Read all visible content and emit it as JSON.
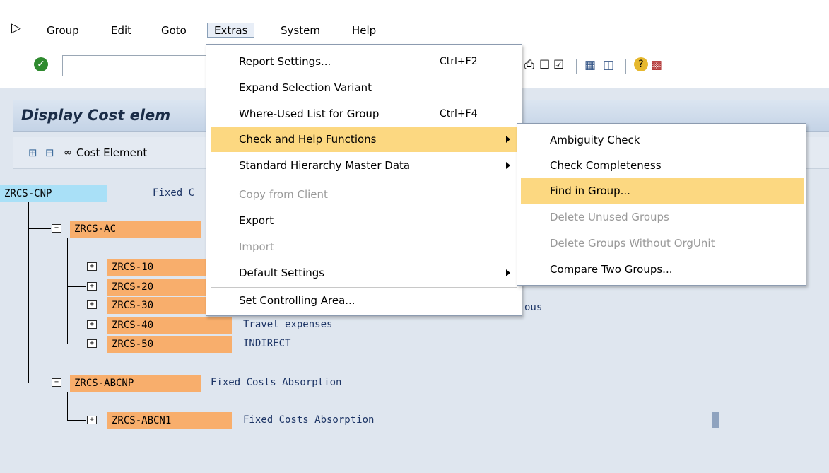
{
  "menubar": {
    "items": [
      "Group",
      "Edit",
      "Goto",
      "Extras",
      "System",
      "Help"
    ],
    "active": "Extras"
  },
  "toolbar": {
    "icons": [
      "enter-check-icon",
      "print-icon",
      "find-icon",
      "find-next-icon",
      "create-session-icon",
      "shortcut-icon",
      "help-icon",
      "customize-layout-icon"
    ]
  },
  "title": "Display Cost elem",
  "app_toolbar": {
    "cost_element_label": "Cost Element"
  },
  "extras_menu": {
    "items": [
      {
        "label": "Report Settings...",
        "shortcut": "Ctrl+F2"
      },
      {
        "label": "Expand Selection Variant",
        "shortcut": ""
      },
      {
        "label": "Where-Used List for Group",
        "shortcut": "Ctrl+F4"
      },
      {
        "label": "Check and Help Functions",
        "shortcut": "",
        "submenu": true,
        "highlighted": true
      },
      {
        "label": "Standard Hierarchy Master Data",
        "shortcut": "",
        "submenu": true
      },
      {
        "label": "Copy from Client",
        "shortcut": "",
        "disabled": true
      },
      {
        "label": "Export",
        "shortcut": ""
      },
      {
        "label": "Import",
        "shortcut": "",
        "disabled": true
      },
      {
        "label": "Default Settings",
        "shortcut": "",
        "submenu": true
      },
      {
        "label": "Set Controlling Area...",
        "shortcut": ""
      }
    ]
  },
  "check_submenu": {
    "items": [
      {
        "label": "Ambiguity Check"
      },
      {
        "label": "Check Completeness"
      },
      {
        "label": "Find in Group...",
        "highlighted": true
      },
      {
        "label": "Delete Unused Groups",
        "disabled": true
      },
      {
        "label": "Delete Groups Without OrgUnit",
        "disabled": true
      },
      {
        "label": "Compare Two Groups..."
      }
    ]
  },
  "tree": {
    "root": {
      "code": "ZRCS-CNP",
      "desc": "Fixed C"
    },
    "ac": {
      "code": "ZRCS-AC"
    },
    "children": [
      {
        "code": "ZRCS-10",
        "desc": ""
      },
      {
        "code": "ZRCS-20",
        "desc": ""
      },
      {
        "code": "ZRCS-30",
        "desc": "ous"
      },
      {
        "code": "ZRCS-40",
        "desc": "Travel expenses"
      },
      {
        "code": "ZRCS-50",
        "desc": "INDIRECT"
      }
    ],
    "abcnp": {
      "code": "ZRCS-ABCNP",
      "desc": "Fixed Costs Absorption"
    },
    "abcn1": {
      "code": "ZRCS-ABCN1",
      "desc": "Fixed Costs Absorption"
    }
  },
  "colors": {
    "highlight": "#fcd881",
    "node_orange": "#f8ae6c",
    "node_blue": "#a9e0f7"
  }
}
